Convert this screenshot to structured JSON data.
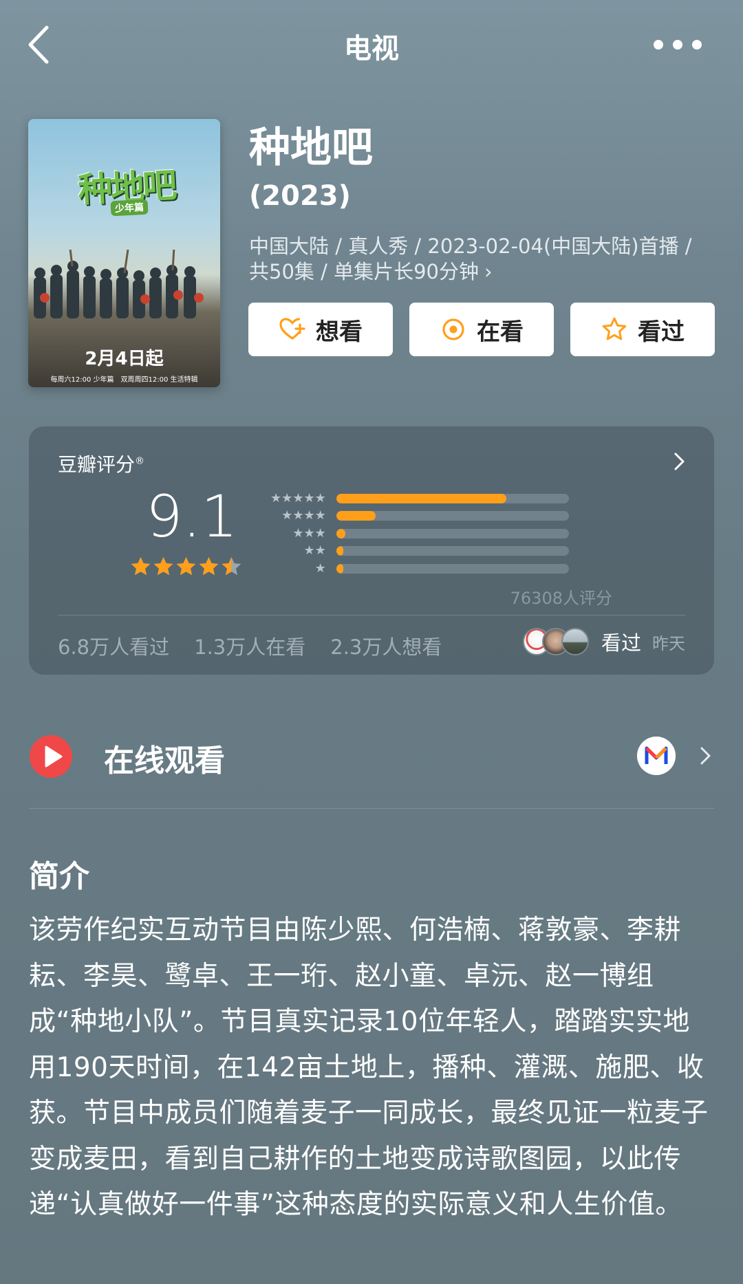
{
  "header": {
    "title": "电视"
  },
  "poster": {
    "logo_text": "种地吧",
    "logo_sub": "少年篇",
    "date_text": "2月4日起",
    "schedule_note": "每周六12:00 少年篇　双周周四12:00 生活特辑"
  },
  "show": {
    "title": "种地吧",
    "year": "(2023)",
    "meta_line1": "中国大陆 / 真人秀 / 2023-02-04(中国大陆)首播 /",
    "meta_line2": "共50集 / 单集片长90分钟",
    "meta_arrow": "›"
  },
  "actions": [
    {
      "label": "想看",
      "icon": "heart-plus-icon"
    },
    {
      "label": "在看",
      "icon": "target-icon"
    },
    {
      "label": "看过",
      "icon": "star-outline-icon"
    }
  ],
  "rating": {
    "label": "豆瓣评分",
    "registered": "®",
    "score": "9.1",
    "stars": 4.5,
    "distribution": [
      {
        "stars": 5,
        "fraction": 0.73
      },
      {
        "stars": 4,
        "fraction": 0.17
      },
      {
        "stars": 3,
        "fraction": 0.04
      },
      {
        "stars": 2,
        "fraction": 0.015
      },
      {
        "stars": 1,
        "fraction": 0.03
      }
    ],
    "count_text": "76308人评分",
    "stats": [
      "6.8万人看过",
      "1.3万人在看",
      "2.3万人想看"
    ],
    "friends_text": "看过",
    "friends_time": "昨天"
  },
  "watch_online": {
    "label": "在线观看"
  },
  "intro": {
    "title": "简介",
    "text": "该劳作纪实互动节目由陈少熙、何浩楠、蒋敦豪、李耕耘、李昊、鹭卓、王一珩、赵小童、卓沅、赵一博组成“种地小队”。节目真实记录10位年轻人，踏踏实实地用190天时间，在142亩土地上，播种、灌溉、施肥、收获。节目中成员们随着麦子一同成长，最终见证一粒麦子变成麦田，看到自己耕作的土地变成诗歌图园，以此传递“认真做好一件事”这种态度的实际意义和人生价值。"
  },
  "colors": {
    "accent": "#ff9f1a",
    "play_red": "#f04848"
  }
}
